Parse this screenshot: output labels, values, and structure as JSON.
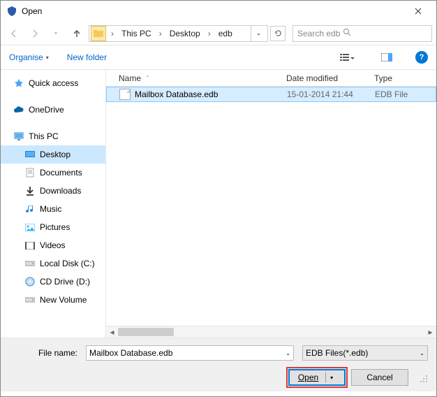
{
  "window": {
    "title": "Open"
  },
  "nav": {
    "crumbs": [
      "This PC",
      "Desktop",
      "edb"
    ],
    "search_placeholder": "Search edb"
  },
  "toolbar": {
    "organise": "Organise",
    "new_folder": "New folder"
  },
  "sidebar": {
    "items": [
      {
        "label": "Quick access",
        "icon": "star",
        "color": "#4aa3ff"
      },
      {
        "label": "OneDrive",
        "icon": "cloud",
        "color": "#0a64a4"
      },
      {
        "label": "This PC",
        "icon": "monitor",
        "color": "#2a7fce"
      },
      {
        "label": "Desktop",
        "icon": "desktop",
        "color": "#2a7fce",
        "indent": true,
        "selected": true
      },
      {
        "label": "Documents",
        "icon": "doc",
        "color": "#888",
        "indent": true
      },
      {
        "label": "Downloads",
        "icon": "download",
        "color": "#333",
        "indent": true
      },
      {
        "label": "Music",
        "icon": "music",
        "color": "#1e88e5",
        "indent": true
      },
      {
        "label": "Pictures",
        "icon": "picture",
        "color": "#29b6f6",
        "indent": true
      },
      {
        "label": "Videos",
        "icon": "video",
        "color": "#555",
        "indent": true
      },
      {
        "label": "Local Disk (C:)",
        "icon": "disk",
        "color": "#999",
        "indent": true
      },
      {
        "label": "CD Drive (D:)",
        "icon": "cd",
        "color": "#1e88e5",
        "indent": true
      },
      {
        "label": "New Volume",
        "icon": "disk",
        "color": "#999",
        "indent": true
      }
    ]
  },
  "columns": {
    "name": "Name",
    "date": "Date modified",
    "type": "Type"
  },
  "files": [
    {
      "name": "Mailbox Database.edb",
      "date": "15-01-2014 21:44",
      "type": "EDB File",
      "selected": true
    }
  ],
  "footer": {
    "filename_label": "File name:",
    "filename_value": "Mailbox Database.edb",
    "filetype": "EDB Files(*.edb)",
    "open": "Open",
    "cancel": "Cancel"
  }
}
